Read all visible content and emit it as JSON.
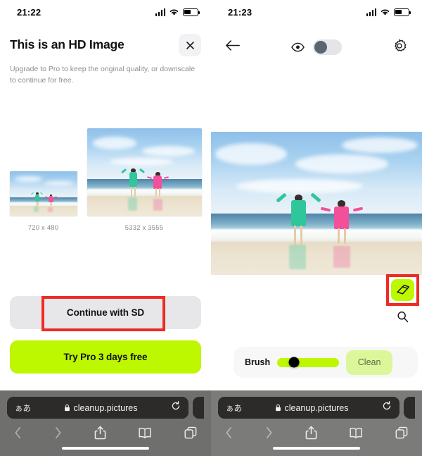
{
  "left_phone": {
    "status_bar": {
      "time": "21:22",
      "signal_icon": "cellular-signal-icon",
      "wifi_icon": "wifi-icon",
      "battery_icon": "battery-icon"
    },
    "dialog": {
      "title": "This is an HD Image",
      "subtitle": "Upgrade to Pro to keep the original quality, or downscale to continue for free.",
      "close_icon": "close-icon"
    },
    "comparison": [
      {
        "label": "720 x 480",
        "kind": "downscaled-preview"
      },
      {
        "label": "5332 x 3555",
        "kind": "original-preview"
      }
    ],
    "buttons": {
      "continue_sd": "Continue with SD",
      "try_pro": "Try Pro 3 days free"
    },
    "annotation": {
      "color": "#ee2b24",
      "target": "Continue with SD"
    },
    "browser": {
      "text_size_label": "ぁあ",
      "lock_icon": "lock-icon",
      "url": "cleanup.pictures",
      "reload_icon": "reload-icon",
      "back_icon": "back-arrow-icon",
      "forward_icon": "forward-arrow-icon",
      "share_icon": "share-icon",
      "bookmarks_icon": "book-icon",
      "tabs_icon": "tabs-icon"
    }
  },
  "right_phone": {
    "status_bar": {
      "time": "21:23",
      "signal_icon": "cellular-signal-icon",
      "wifi_icon": "wifi-icon",
      "battery_icon": "battery-icon"
    },
    "toolbar": {
      "back_icon": "back-arrow-icon",
      "eye_icon": "eye-icon",
      "toggle_state": "off",
      "settings_icon": "gear-icon"
    },
    "editor": {
      "eraser_icon": "eraser-icon",
      "zoom_icon": "magnifier-icon",
      "brush_label": "Brush",
      "brush_value_percent": 27,
      "clean_label": "Clean"
    },
    "annotation": {
      "color": "#ee2b24",
      "target": "eraser tool"
    },
    "browser": {
      "text_size_label": "ぁあ",
      "lock_icon": "lock-icon",
      "url": "cleanup.pictures",
      "reload_icon": "reload-icon",
      "back_icon": "back-arrow-icon",
      "forward_icon": "forward-arrow-icon",
      "share_icon": "share-icon",
      "bookmarks_icon": "book-icon",
      "tabs_icon": "tabs-icon"
    }
  },
  "colors": {
    "lime": "#bdf700",
    "lime_soft": "#dcf79a",
    "annotation_red": "#ee2b24",
    "button_gray": "#e7e7ea"
  }
}
